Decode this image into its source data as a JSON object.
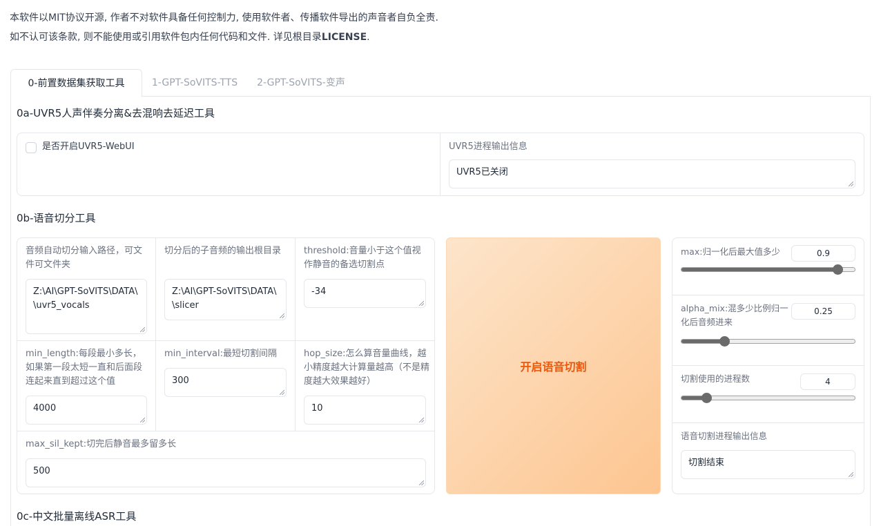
{
  "notice": {
    "line1": "本软件以MIT协议开源, 作者不对软件具备任何控制力, 使用软件者、传播软件导出的声音者自负全责.",
    "line2_prefix": "如不认可该条款, 则不能使用或引用软件包内任何代码和文件. 详见根目录",
    "line2_bold": "LICENSE",
    "line2_suffix": "."
  },
  "tabs": [
    {
      "label": "0-前置数据集获取工具",
      "active": true
    },
    {
      "label": "1-GPT-SoVITS-TTS",
      "active": false
    },
    {
      "label": "2-GPT-SoVITS-变声",
      "active": false
    }
  ],
  "uvr5": {
    "title": "0a-UVR5人声伴奏分离&去混响去延迟工具",
    "enable_label": "是否开启UVR5-WebUI",
    "enable_checked": false,
    "output_label": "UVR5进程输出信息",
    "output_value": "UVR5已关闭"
  },
  "slicer": {
    "title": "0b-语音切分工具",
    "input_path_label": "音频自动切分输入路径，可文件可文件夹",
    "input_path_value": "Z:\\AI\\GPT-SoVITS\\DATA\\        \\uvr5_vocals",
    "output_root_label": "切分后的子音频的输出根目录",
    "output_root_value": "Z:\\AI\\GPT-SoVITS\\DATA\\        \\slicer",
    "threshold_label": "threshold:音量小于这个值视作静音的备选切割点",
    "threshold_value": "-34",
    "min_length_label": "min_length:每段最小多长，如果第一段太短一直和后面段连起来直到超过这个值",
    "min_length_value": "4000",
    "min_interval_label": "min_interval:最短切割间隔",
    "min_interval_value": "300",
    "hop_size_label": "hop_size:怎么算音量曲线，越小精度越大计算量越高（不是精度越大效果越好）",
    "hop_size_value": "10",
    "max_sil_kept_label": "max_sil_kept:切完后静音最多留多长",
    "max_sil_kept_value": "500",
    "start_button": "开启语音切割",
    "max_label": "max:归一化后最大值多少",
    "max_value": "0.9",
    "max_fraction": 0.9,
    "alpha_mix_label": "alpha_mix:混多少比例归一化后音频进来",
    "alpha_mix_value": "0.25",
    "alpha_mix_fraction": 0.25,
    "n_process_label": "切割使用的进程数",
    "n_process_value": "4",
    "n_process_fraction": 0.15,
    "progress_label": "语音切割进程输出信息",
    "progress_value": "切割结束"
  },
  "asr": {
    "title": "0c-中文批量离线ASR工具"
  },
  "colors": {
    "accent_text": "#ea580c",
    "button_gradient_start": "#fde5cb",
    "button_gradient_end": "#fdc590",
    "slider": "#6b6b6b"
  }
}
